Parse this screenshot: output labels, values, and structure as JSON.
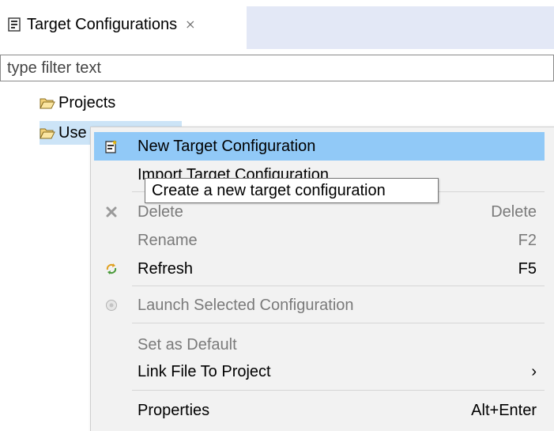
{
  "tab": {
    "title": "Target Configurations",
    "close_glyph": "⨯",
    "icon": "target-config-icon"
  },
  "filter": {
    "placeholder": "type filter text"
  },
  "tree": {
    "items": [
      {
        "label": "Projects",
        "icon": "folder-open-icon"
      },
      {
        "label": "Use",
        "icon": "folder-open-icon"
      }
    ]
  },
  "context_menu": {
    "items": [
      {
        "label": "New Target Configuration",
        "shortcut": "",
        "icon": "new-target-config-icon",
        "enabled": true,
        "selected": true
      },
      {
        "label": "Import Target Configuration",
        "shortcut": "",
        "icon": "",
        "enabled": true,
        "selected": false
      },
      {
        "label": "Delete",
        "shortcut": "Delete",
        "icon": "delete-icon",
        "enabled": false,
        "selected": false
      },
      {
        "label": "Rename",
        "shortcut": "F2",
        "icon": "",
        "enabled": false,
        "selected": false
      },
      {
        "label": "Refresh",
        "shortcut": "F5",
        "icon": "refresh-icon",
        "enabled": true,
        "selected": false
      },
      {
        "label": "Launch Selected Configuration",
        "shortcut": "",
        "icon": "launch-icon",
        "enabled": false,
        "selected": false
      },
      {
        "label": "Set as Default",
        "shortcut": "",
        "icon": "",
        "enabled": false,
        "selected": false
      },
      {
        "label": "Link File To Project",
        "shortcut": "›",
        "icon": "",
        "enabled": true,
        "selected": false
      },
      {
        "label": "Properties",
        "shortcut": "Alt+Enter",
        "icon": "",
        "enabled": true,
        "selected": false
      }
    ]
  },
  "tooltip": {
    "text": "Create a new target configuration"
  },
  "colors": {
    "selection": "#91c9f7",
    "tree_selection": "#cce4f7",
    "menu_bg": "#f2f2f2",
    "tab_strip": "#e3e8f6",
    "disabled_text": "#7a7a7a"
  }
}
